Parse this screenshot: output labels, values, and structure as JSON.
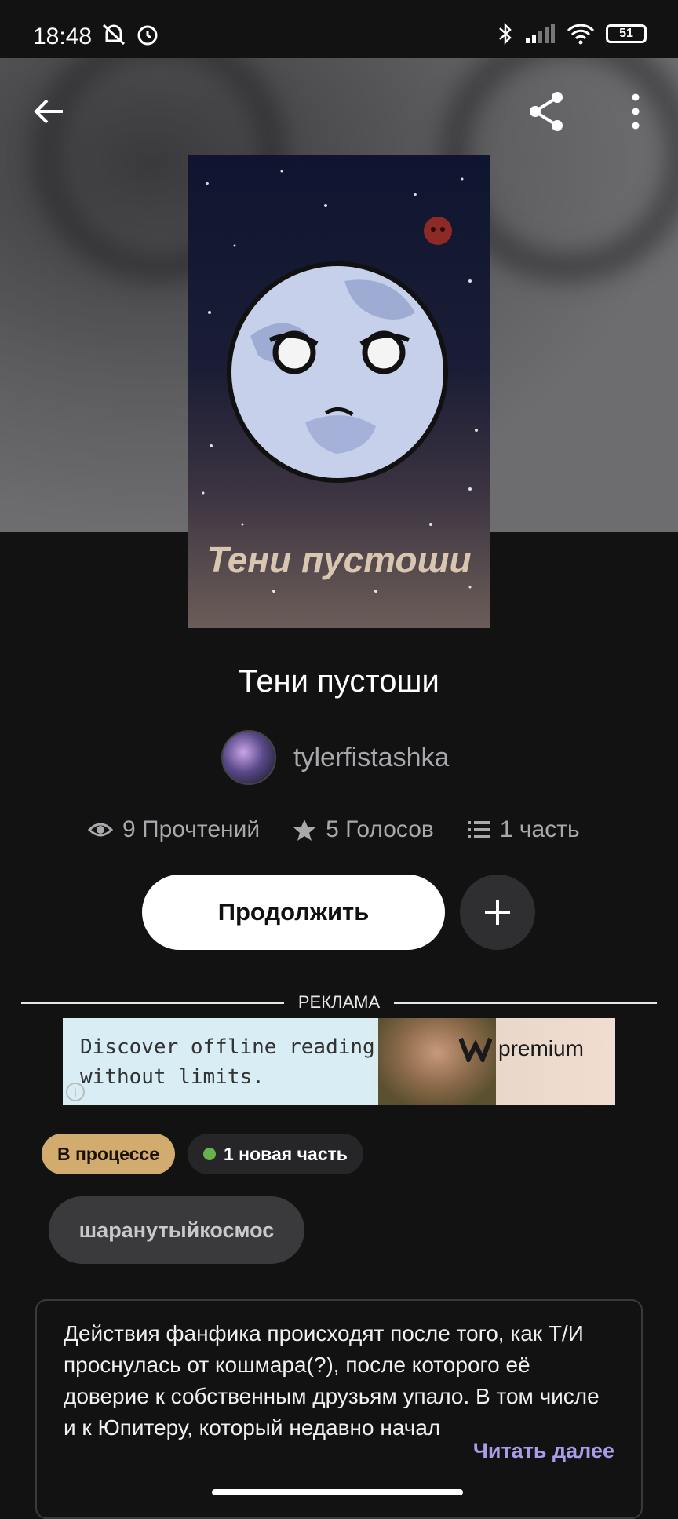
{
  "status_bar": {
    "time": "18:48",
    "battery": "51"
  },
  "story": {
    "cover_text": "Тени пустоши",
    "title": "Тени пустоши",
    "author": "tylerfistashka",
    "stats": {
      "reads": "9 Прочтений",
      "votes": "5 Голосов",
      "parts": "1 часть"
    }
  },
  "actions": {
    "continue_label": "Продолжить"
  },
  "ad": {
    "label": "РЕКЛАМА",
    "line1": "Discover offline reading",
    "line2": "without limits.",
    "brand": "premium"
  },
  "chips": {
    "status": "В процессе",
    "new_part": "1 новая часть",
    "tag": "шаранутыйкосмос"
  },
  "description": {
    "text": "Действия фанфика происходят после того, как Т/И проснулась от кошмара(?), после которого её доверие к собственным друзьям упало. В том числе и к Юпитеру, который недавно начал",
    "read_more": "Читать далее"
  },
  "icons": [
    "back-arrow-icon",
    "share-icon",
    "more-vert-icon",
    "eye-icon",
    "star-icon",
    "list-icon",
    "plus-icon"
  ]
}
